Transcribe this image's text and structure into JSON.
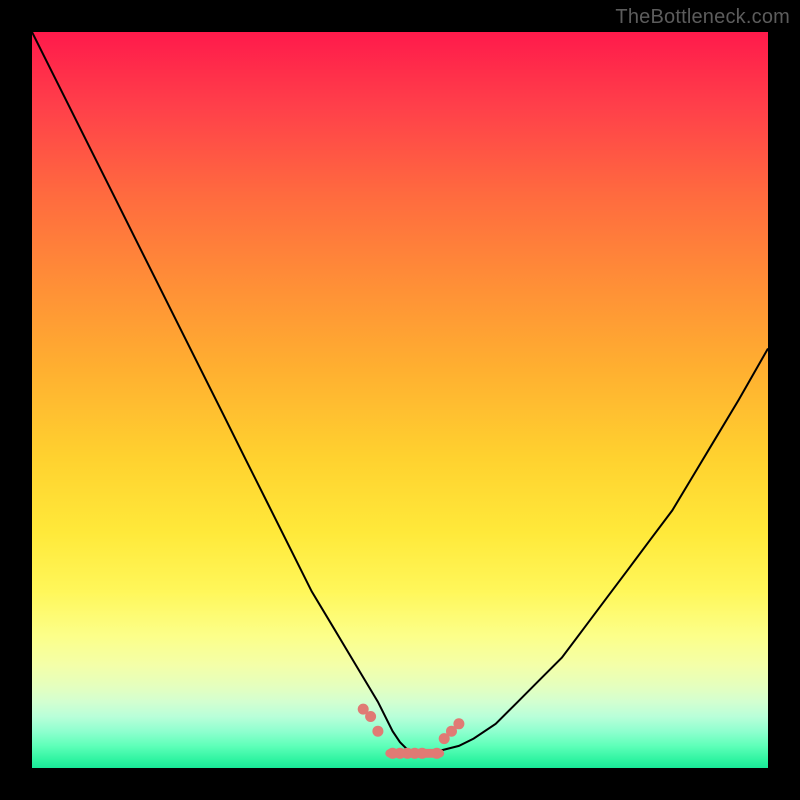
{
  "watermark": "TheBottleneck.com",
  "colors": {
    "frame": "#000000",
    "curve": "#000000",
    "marker": "#e07a74",
    "watermark": "#5c5c5c"
  },
  "chart_data": {
    "type": "line",
    "title": "",
    "xlabel": "",
    "ylabel": "",
    "xlim": [
      0,
      100
    ],
    "ylim": [
      0,
      100
    ],
    "x": [
      0,
      2,
      5,
      8,
      11,
      14,
      17,
      20,
      23,
      26,
      29,
      32,
      35,
      38,
      41,
      44,
      47,
      49,
      50,
      51,
      52,
      53,
      54,
      56,
      58,
      60,
      63,
      66,
      69,
      72,
      75,
      78,
      81,
      84,
      87,
      90,
      93,
      96,
      100
    ],
    "values": [
      100,
      96,
      90,
      84,
      78,
      72,
      66,
      60,
      54,
      48,
      42,
      36,
      30,
      24,
      19,
      14,
      9,
      5,
      3.5,
      2.5,
      2,
      2,
      2,
      2.5,
      3,
      4,
      6,
      9,
      12,
      15,
      19,
      23,
      27,
      31,
      35,
      40,
      45,
      50,
      57
    ],
    "markers": {
      "x": [
        45,
        46,
        47,
        49,
        50,
        51,
        52,
        53,
        55,
        56,
        57,
        58
      ],
      "y": [
        8,
        7,
        5,
        2,
        2,
        2,
        2,
        2,
        2,
        4,
        5,
        6
      ]
    },
    "bottom_bar": {
      "x_start": 48,
      "x_end": 56,
      "y": 2,
      "height": 1.2
    }
  }
}
